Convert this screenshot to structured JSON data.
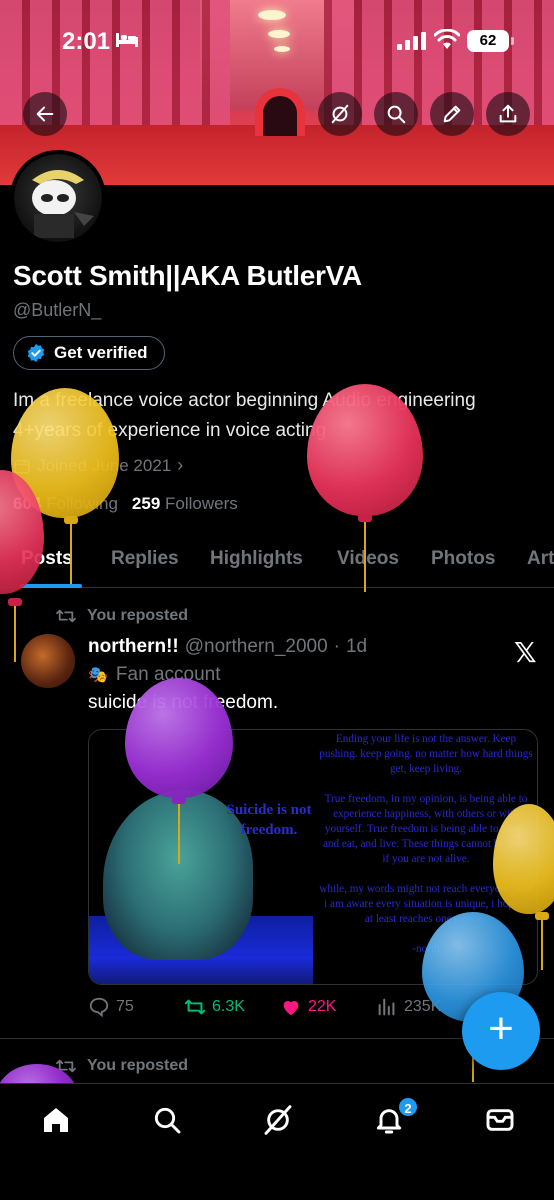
{
  "status_bar": {
    "time": "2:01",
    "battery": "62"
  },
  "profile": {
    "name": "Scott Smith||AKA ButlerVA",
    "handle": "@ButlerN_",
    "verify_label": "Get verified",
    "bio_line1": "Im a freelance voice actor beginning Audio engineering",
    "bio_line2": "4+years of experience in voice acting",
    "joined": "Joined June 2021",
    "following_count": "604",
    "following_label": "Following",
    "followers_count": "259",
    "followers_label": "Followers"
  },
  "tabs": [
    "Posts",
    "Replies",
    "Highlights",
    "Videos",
    "Photos",
    "Art"
  ],
  "post": {
    "repost_label": "You reposted",
    "author": "northern!!",
    "username": "@northern_2000",
    "time": "1d",
    "label": "Fan account",
    "text": "suicide is not freedom.",
    "media_caption": "Suicide is not freedom.",
    "media_letter": "Ending your life is not the answer. Keep pushing. keep going. no matter how hard things get, keep living.\n\nTrue freedom, in my opinion, is being able to experience happiness, with others or with yourself. True freedom is being able to sleep, and eat, and live. These things cannot be done if you are not alive.\n\nwhile, my words might not reach everyone, and i am aware every situation is unique, i hope it at least reaches one person.\n\n-north",
    "replies": "75",
    "reposts": "6.3K",
    "likes": "22K",
    "views": "235K"
  },
  "next_post": {
    "repost_label": "You reposted"
  },
  "nav": {
    "notifications_badge": "2"
  },
  "colors": {
    "accent": "#1d9bf0",
    "repost_green": "#00ba7c",
    "like_pink": "#f91880",
    "muted": "#71767b",
    "balloon_yellow": "#f2c21c",
    "balloon_red": "#e8335a",
    "balloon_purple": "#9b2fd6",
    "balloon_blue": "#2f9be8"
  },
  "icons": {
    "back": "arrow-left-icon",
    "grok": "grok-icon",
    "search": "search-icon",
    "edit": "pencil-icon",
    "share": "share-icon",
    "verified": "verified-badge-icon",
    "calendar": "calendar-icon",
    "home": "home-icon",
    "notifications": "bell-icon",
    "messages": "mail-icon",
    "compose": "plus-icon"
  }
}
